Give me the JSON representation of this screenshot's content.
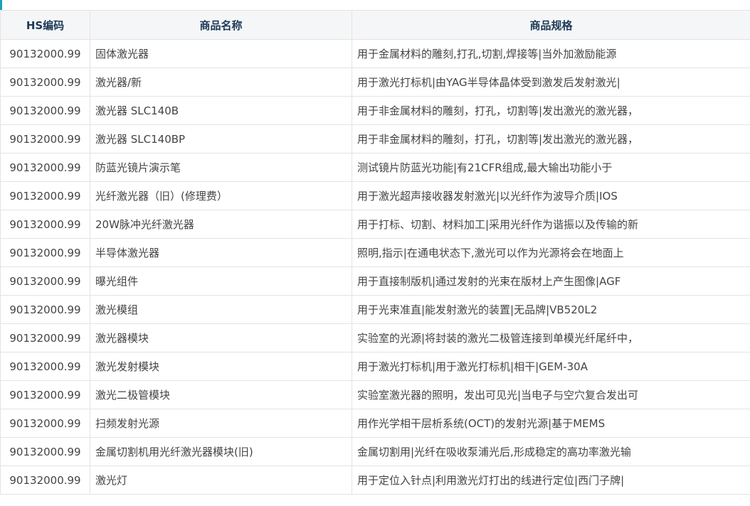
{
  "colors": {
    "accent": "#17a2b8",
    "header_bg": "#f5f6f7",
    "header_text": "#1c3a57",
    "cell_text": "#444444",
    "border": "#e3e3e3"
  },
  "table": {
    "headers": [
      "HS编码",
      "商品名称",
      "商品规格"
    ],
    "rows": [
      [
        "90132000.99",
        "固体激光器",
        "用于金属材料的雕刻,打孔,切割,焊接等|当外加激励能源"
      ],
      [
        "90132000.99",
        "激光器/新",
        "用于激光打标机|由YAG半导体晶体受到激发后发射激光|"
      ],
      [
        "90132000.99",
        "激光器 SLC140B",
        "用于非金属材料的雕刻，打孔，切割等|发出激光的激光器，"
      ],
      [
        "90132000.99",
        "激光器 SLC140BP",
        "用于非金属材料的雕刻，打孔，切割等|发出激光的激光器，"
      ],
      [
        "90132000.99",
        "防蓝光镜片演示笔",
        "测试镜片防蓝光功能|有21CFR组成,最大输出功能小于"
      ],
      [
        "90132000.99",
        "光纤激光器（旧）(修理费）",
        "用于激光超声接收器发射激光|以光纤作为波导介质|IOS"
      ],
      [
        "90132000.99",
        "20W脉冲光纤激光器",
        "用于打标、切割、材料加工|采用光纤作为谐振以及传输的新"
      ],
      [
        "90132000.99",
        "半导体激光器",
        "照明,指示|在通电状态下,激光可以作为光源将会在地面上"
      ],
      [
        "90132000.99",
        "曝光组件",
        "用于直接制版机|通过发射的光束在版材上产生图像|AGF"
      ],
      [
        "90132000.99",
        "激光模组",
        "用于光束准直|能发射激光的装置|无品牌|VB520L2"
      ],
      [
        "90132000.99",
        "激光器模块",
        "实验室的光源|将封装的激光二极管连接到单模光纤尾纤中，"
      ],
      [
        "90132000.99",
        "激光发射模块",
        "用于激光打标机|用于激光打标机|相干|GEM-30A"
      ],
      [
        "90132000.99",
        "激光二极管模块",
        "实验室激光器的照明，发出可见光|当电子与空穴复合发出可"
      ],
      [
        "90132000.99",
        "扫频发射光源",
        "用作光学相干层析系统(OCT)的发射光源|基于MEMS"
      ],
      [
        "90132000.99",
        "金属切割机用光纤激光器模块(旧)",
        "金属切割用|光纤在吸收泵浦光后,形成稳定的高功率激光输"
      ],
      [
        "90132000.99",
        "激光灯",
        "用于定位入针点|利用激光灯打出的线进行定位|西门子牌|"
      ]
    ]
  }
}
